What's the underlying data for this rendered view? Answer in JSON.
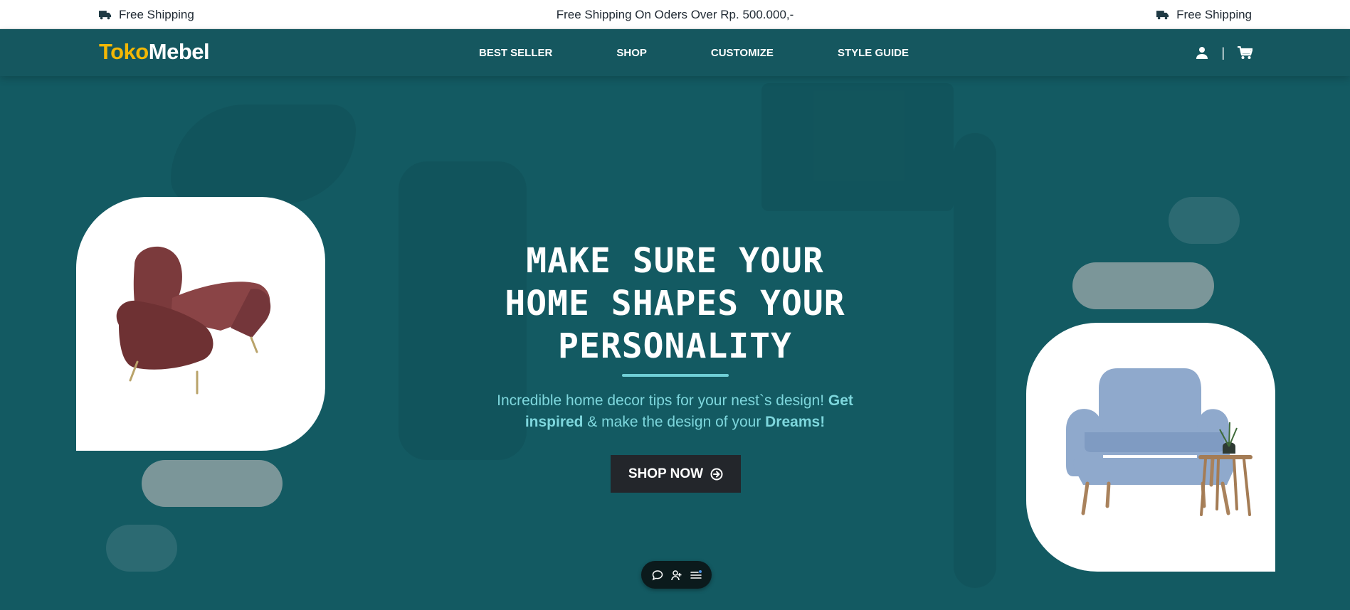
{
  "topbar": {
    "left_text": "Free Shipping",
    "center_text": "Free Shipping On Oders Over Rp. 500.000,-",
    "right_text": "Free Shipping",
    "icon": "truck-icon"
  },
  "brand": {
    "part1": "Toko",
    "part2": "Mebel",
    "part1_color": "#f2b705",
    "part2_color": "#ffffff"
  },
  "nav": {
    "links": [
      "BEST SELLER",
      "SHOP",
      "CUSTOMIZE",
      "STYLE GUIDE"
    ],
    "icons": [
      "user-icon",
      "cart-icon"
    ],
    "separator": "|"
  },
  "hero": {
    "headline_line1": "MAKE SURE YOUR",
    "headline_line2": "HOME SHAPES YOUR",
    "headline_line3": "PERSONALITY",
    "sub_part1": "Incredible home decor tips for your nest`s design! ",
    "sub_bold1": "Get inspired",
    "sub_part2": " & make the design of your ",
    "sub_bold2": "Dreams!",
    "cta_label": "SHOP NOW",
    "cta_icon": "arrow-circle-right-icon",
    "left_product": "armchair-image",
    "right_product": "blue-armchair-image"
  },
  "floating_toolbar": {
    "icons": [
      "chat-icon",
      "add-user-icon",
      "menu-list-icon"
    ]
  },
  "colors": {
    "primary_teal": "#135a62",
    "nav_teal": "#15575f",
    "accent_yellow": "#f2b705",
    "accent_cyan": "#7ed7dd",
    "button_dark": "#23262b"
  }
}
